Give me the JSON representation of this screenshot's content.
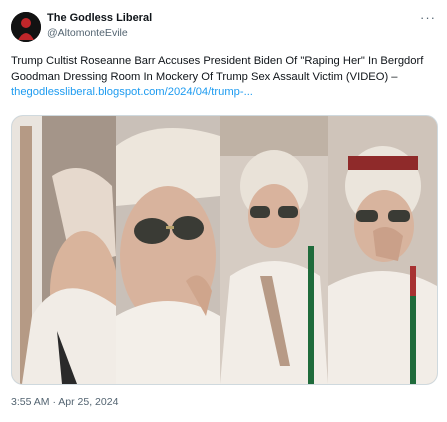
{
  "author": {
    "display_name": "The Godless Liberal",
    "handle": "@AltomonteEvile",
    "avatar_icon": "profile-avatar"
  },
  "more_icon": "ellipsis-icon",
  "tweet": {
    "text": "Trump Cultist Roseanne Barr Accuses President Biden Of \"Raping Her\" In Bergdorf Goodman Dressing Room In Mockery Of Trump Sex Assault Victim (VIDEO) – ",
    "link_text": "thegodlessliberal.blogspot.com/2024/04/trump-..."
  },
  "media": {
    "panels": [
      "video-frame-1",
      "video-frame-2",
      "video-frame-3"
    ]
  },
  "timestamp": "3:55 AM · Apr 25, 2024",
  "colors": {
    "link": "#1d9bf0",
    "secondary_text": "#536471",
    "border": "#cfd9de"
  }
}
